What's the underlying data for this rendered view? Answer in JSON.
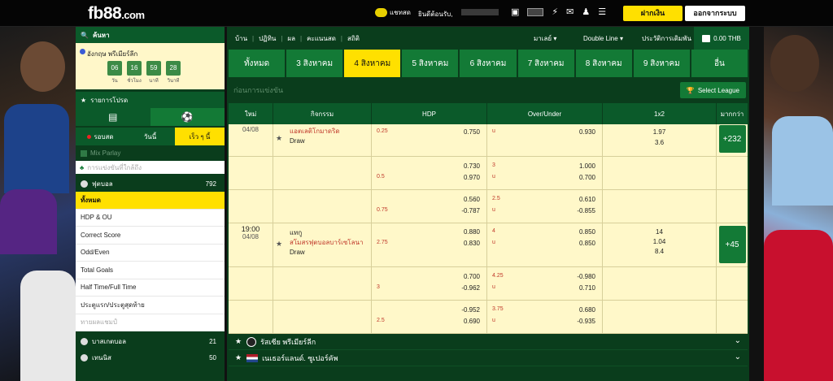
{
  "header": {
    "logo": "fb88",
    "logo_suffix": ".com",
    "chat_label": "แชทสด",
    "welcome": "ยินดีต้อนรับ,",
    "deposit_label": "ฝากเงิน",
    "logout_label": "ออกจากระบบ"
  },
  "sidebar": {
    "search_label": "ค้นหา",
    "promo_title": "อังกฤษ พรีเมียร์ลีก",
    "countdown": [
      {
        "num": "06",
        "label": "วัน"
      },
      {
        "num": "16",
        "label": "ชั่วโมง"
      },
      {
        "num": "59",
        "label": "นาที"
      },
      {
        "num": "28",
        "label": "วินาที"
      }
    ],
    "sports_header": "รายการโปรด",
    "tabs": {
      "live": "รอบสด",
      "today": "วันนี้",
      "early": "เร็ว ๆ นี้"
    },
    "mix_parlay": "Mix Parlay",
    "upcoming_label": "การแข่งขันที่ใกล้ถึง",
    "football": {
      "label": "ฟุตบอล",
      "count": "792"
    },
    "menu": [
      "ทั้งหมด",
      "HDP & OU",
      "Correct Score",
      "Odd/Even",
      "Total Goals",
      "Half Time/Full Time",
      "ประตูแรก/ประตูสุดท้าย",
      "ทายผลแชมป์"
    ],
    "basketball": {
      "label": "บาสเกตบอล",
      "count": "21"
    },
    "tennis": {
      "label": "เทนนิส",
      "count": "50"
    }
  },
  "nav": {
    "items": [
      "บ้าน",
      "ปฏิทิน",
      "ผล",
      "คะแนนสด",
      "สถิติ"
    ],
    "lang": "มาเลย์",
    "odds_type": "Double Line",
    "history": "ประวัติการเดิมพัน",
    "balance": "0.00 THB"
  },
  "dates": [
    "ทั้งหมด",
    "3 สิงหาคม",
    "4 สิงหาคม",
    "5 สิงหาคม",
    "6 สิงหาคม",
    "7 สิงหาคม",
    "8 สิงหาคม",
    "9 สิงหาคม",
    "อื่น"
  ],
  "subheader": {
    "title": "ก่อนการแข่งขัน",
    "select_league": "Select League"
  },
  "columns": {
    "time": "ใหม่",
    "event": "กิจกรรม",
    "hdp": "HDP",
    "ou": "Over/Under",
    "x12": "1x2",
    "more": "มากกว่า"
  },
  "match1": {
    "date": "04/08",
    "team": "แอตเลติโกมาดริด",
    "draw": "Draw",
    "hdp": [
      [
        "0.25",
        "0.750",
        ""
      ],
      [
        "0.5",
        "0.730",
        "0.970"
      ],
      [
        "0.75",
        "0.560",
        "-0.787"
      ]
    ],
    "ou": [
      [
        "u",
        "0.930",
        ""
      ],
      [
        "3",
        "1.000",
        "0.700"
      ],
      [
        "2.5",
        "0.610",
        "-0.855"
      ]
    ],
    "x12": [
      "1.97",
      "3.6"
    ],
    "more": "+232"
  },
  "match2": {
    "time": "19:00",
    "date": "04/08",
    "home": "แทกู",
    "away": "สโมสรฟุตบอลบาร์เซโลนา",
    "draw": "Draw",
    "hdp": [
      [
        "2.75",
        "0.880",
        "0.830"
      ],
      [
        "3",
        "0.700",
        "-0.962"
      ],
      [
        "2.5",
        "-0.952",
        "0.690"
      ]
    ],
    "ou": [
      [
        "4",
        "0.850",
        "0.850"
      ],
      [
        "4.25",
        "-0.980",
        "0.710"
      ],
      [
        "3.75",
        "0.680",
        "-0.935"
      ]
    ],
    "x12": [
      "14",
      "1.04",
      "8.4"
    ],
    "more": "+45"
  },
  "leagues": [
    {
      "name": "รัสเซีย พรีเมียร์ลีก"
    },
    {
      "name": "เนเธอร์แลนด์. ซูเปอร์คัพ"
    }
  ]
}
